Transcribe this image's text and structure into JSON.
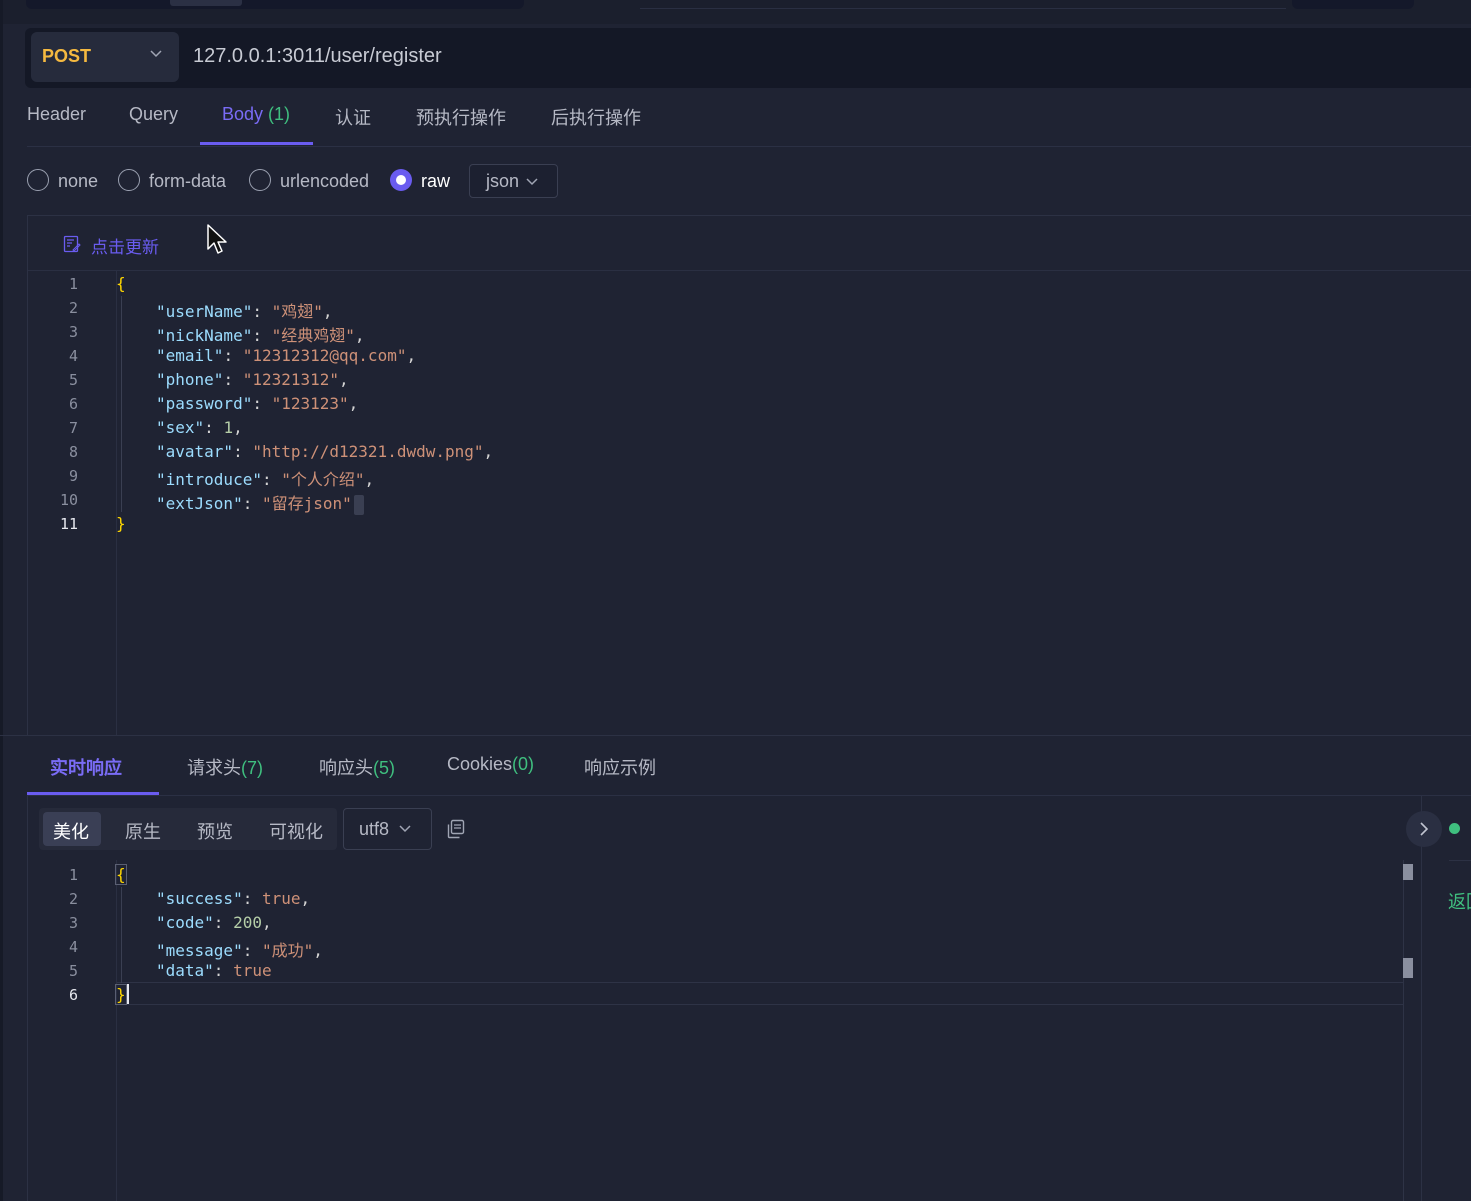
{
  "request": {
    "method": "POST",
    "url": "127.0.0.1:3011/user/register"
  },
  "request_tabs": [
    {
      "label": "Header"
    },
    {
      "label": "Query"
    },
    {
      "label": "Body ",
      "count": "(1)"
    },
    {
      "label": "认证"
    },
    {
      "label": "预执行操作"
    },
    {
      "label": "后执行操作"
    }
  ],
  "body_types": {
    "options": [
      "none",
      "form-data",
      "urlencoded",
      "raw"
    ],
    "selected": "raw",
    "format": "json"
  },
  "editor": {
    "update_label": "点击更新",
    "line_numbers": [
      "1",
      "2",
      "3",
      "4",
      "5",
      "6",
      "7",
      "8",
      "9",
      "10",
      "11"
    ],
    "fields": {
      "userName": {
        "key": "\"userName\"",
        "value": "\"鸡翅\""
      },
      "nickName": {
        "key": "\"nickName\"",
        "value": "\"经典鸡翅\""
      },
      "email": {
        "key": "\"email\"",
        "value": "\"12312312@qq.com\""
      },
      "phone": {
        "key": "\"phone\"",
        "value": "\"12321312\""
      },
      "password": {
        "key": "\"password\"",
        "value": "\"123123\""
      },
      "sex": {
        "key": "\"sex\"",
        "value": "1"
      },
      "avatar": {
        "key": "\"avatar\"",
        "value": "\"http://d12321.dwdw.png\""
      },
      "introduce": {
        "key": "\"introduce\"",
        "value": "\"个人介绍\""
      },
      "extJson": {
        "key": "\"extJson\"",
        "value": "\"留存json\""
      }
    }
  },
  "response_tabs": [
    {
      "label": "实时响应",
      "count": ""
    },
    {
      "label": "请求头",
      "count": "(7)"
    },
    {
      "label": "响应头",
      "count": "(5)"
    },
    {
      "label": "Cookies",
      "count": "(0)"
    },
    {
      "label": "响应示例",
      "count": ""
    }
  ],
  "view_modes": [
    "美化",
    "原生",
    "预览",
    "可视化"
  ],
  "encoding": "utf8",
  "response": {
    "line_numbers": [
      "1",
      "2",
      "3",
      "4",
      "5",
      "6"
    ],
    "fields": {
      "success": {
        "key": "\"success\"",
        "value": "true"
      },
      "code": {
        "key": "\"code\"",
        "value": "200"
      },
      "message": {
        "key": "\"message\"",
        "value": "\"成功\""
      },
      "data": {
        "key": "\"data\"",
        "value": "true"
      }
    }
  },
  "side_panel": {
    "return_label": "返回"
  },
  "colors": {
    "accent": "#6a5cf0",
    "method": "#f5b940",
    "success": "#3fbf7f",
    "background": "#1f2333"
  }
}
